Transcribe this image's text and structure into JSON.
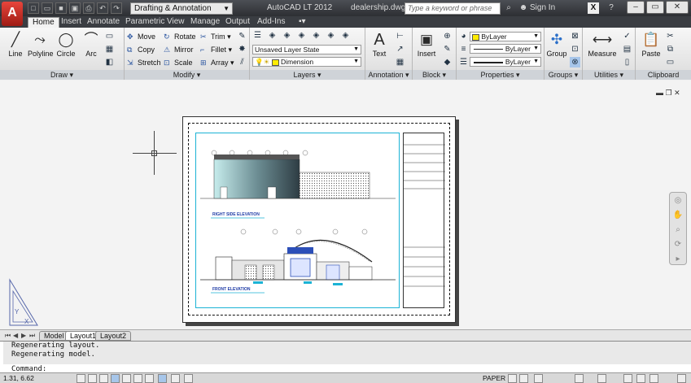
{
  "titlebar": {
    "app_logo": "A",
    "workspace": "Drafting & Annotation",
    "app_name": "AutoCAD LT 2012",
    "file_name": "dealership.dwg",
    "search_placeholder": "Type a keyword or phrase",
    "sign_in": "Sign In"
  },
  "tabs": [
    "Home",
    "Insert",
    "Annotate",
    "Parametric",
    "View",
    "Manage",
    "Output",
    "Add-Ins"
  ],
  "ribbon": {
    "draw": {
      "title": "Draw",
      "tools": [
        "Line",
        "Polyline",
        "Circle",
        "Arc"
      ]
    },
    "modify": {
      "title": "Modify",
      "tools": [
        "Move",
        "Rotate",
        "Trim",
        "Copy",
        "Mirror",
        "Fillet",
        "Stretch",
        "Scale",
        "Array"
      ]
    },
    "layers": {
      "title": "Layers",
      "layer_state": "Unsaved Layer State",
      "current_layer": "Dimension"
    },
    "annotation": {
      "title": "Annotation",
      "text_label": "Text"
    },
    "block": {
      "title": "Block",
      "insert_label": "Insert"
    },
    "properties": {
      "title": "Properties",
      "color": "ByLayer",
      "linetype": "ByLayer",
      "lineweight": "ByLayer"
    },
    "groups": {
      "title": "Groups",
      "group_label": "Group"
    },
    "utilities": {
      "title": "Utilities",
      "measure_label": "Measure"
    },
    "clipboard": {
      "title": "Clipboard",
      "paste_label": "Paste"
    }
  },
  "drawing": {
    "label_right": "RIGHT SIDE ELEVATION",
    "label_front": "FRONT ELEVATION"
  },
  "layout_tabs": [
    "Model",
    "Layout1",
    "Layout2"
  ],
  "command": {
    "history": [
      "Regenerating layout.",
      "Regenerating model."
    ],
    "prompt": "Command:"
  },
  "status": {
    "coords": "1.31, 6.62",
    "space": "PAPER"
  },
  "colors": {
    "accent": "#1cb3d5",
    "ribbon_tab_bg": "#3a3d42",
    "logo_red": "#c8322a"
  }
}
